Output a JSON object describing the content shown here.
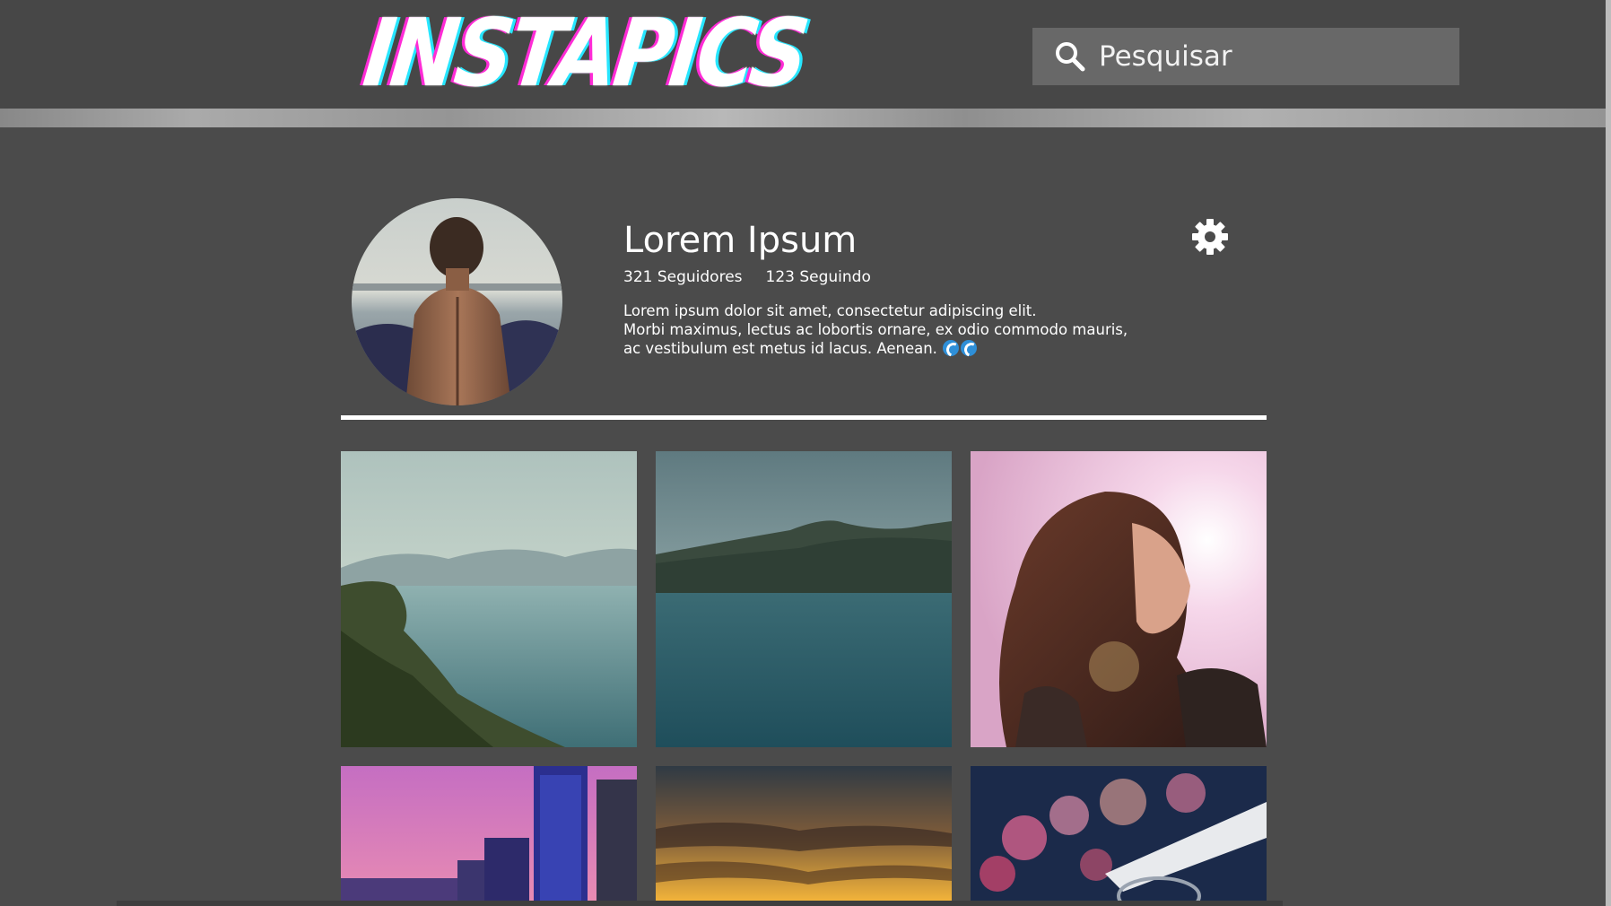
{
  "header": {
    "logo_text": "INSTAPICS",
    "search_placeholder": "Pesquisar",
    "search_icon": "search-icon"
  },
  "profile": {
    "name": "Lorem Ipsum",
    "followers": "321 Seguidores",
    "following": "123 Seguindo",
    "bio_lines": [
      "Lorem ipsum dolor sit amet, consectetur adipiscing elit.",
      "Morbi maximus, lectus ac lobortis ornare, ex odio commodo mauris,",
      "ac vestibulum est metus id lacus. Aenean."
    ],
    "bio_emoji": [
      "wave-icon",
      "wave-icon"
    ],
    "settings_icon": "gear-icon"
  },
  "photos": [
    {
      "subject": "lake with green hills"
    },
    {
      "subject": "lake with mountain"
    },
    {
      "subject": "woman in sunlight"
    },
    {
      "subject": "city skyline at dusk"
    },
    {
      "subject": "sunset clouds"
    },
    {
      "subject": "bokeh city lights"
    }
  ],
  "colors": {
    "background": "#4b4b4b",
    "header": "#474747",
    "search_box": "#686868",
    "logo_magenta": "#ff2bd6",
    "logo_cyan": "#27e6ff"
  }
}
